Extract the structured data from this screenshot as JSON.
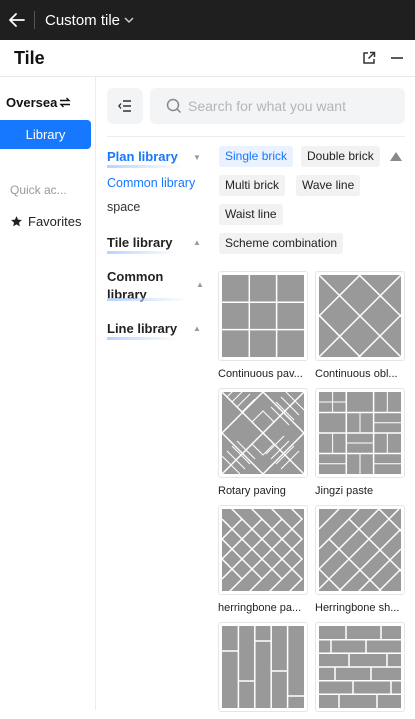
{
  "topbar": {
    "title": "Custom tile"
  },
  "panel": {
    "title": "Tile"
  },
  "left": {
    "oversea": "Oversea",
    "library": "Library",
    "quick_access": "Quick ac...",
    "favorites": "Favorites"
  },
  "search": {
    "placeholder": "Search for what you want"
  },
  "categories": {
    "plan_library": "Plan library",
    "common_library_sub": "Common library",
    "space_sub": "space",
    "tile_library": "Tile library",
    "common_library": "Common library",
    "line_library": "Line library"
  },
  "tags": [
    "Single brick",
    "Double brick",
    "Multi brick",
    "Wave line",
    "Waist line",
    "Scheme combination"
  ],
  "tiles": [
    {
      "label": "Continuous pav...",
      "pattern": "grid"
    },
    {
      "label": "Continuous obl...",
      "pattern": "diagonal-grid"
    },
    {
      "label": "Rotary paving",
      "pattern": "rotary"
    },
    {
      "label": "Jingzi paste",
      "pattern": "jingzi"
    },
    {
      "label": "herringbone pa...",
      "pattern": "herringbone"
    },
    {
      "label": "Herringbone sh...",
      "pattern": "herringbone"
    },
    {
      "label": "",
      "pattern": "vertical-strips"
    },
    {
      "label": "",
      "pattern": "brick"
    }
  ],
  "colors": {
    "accent": "#1677ff",
    "tile_fill": "#999999",
    "grout": "#ffffff"
  }
}
